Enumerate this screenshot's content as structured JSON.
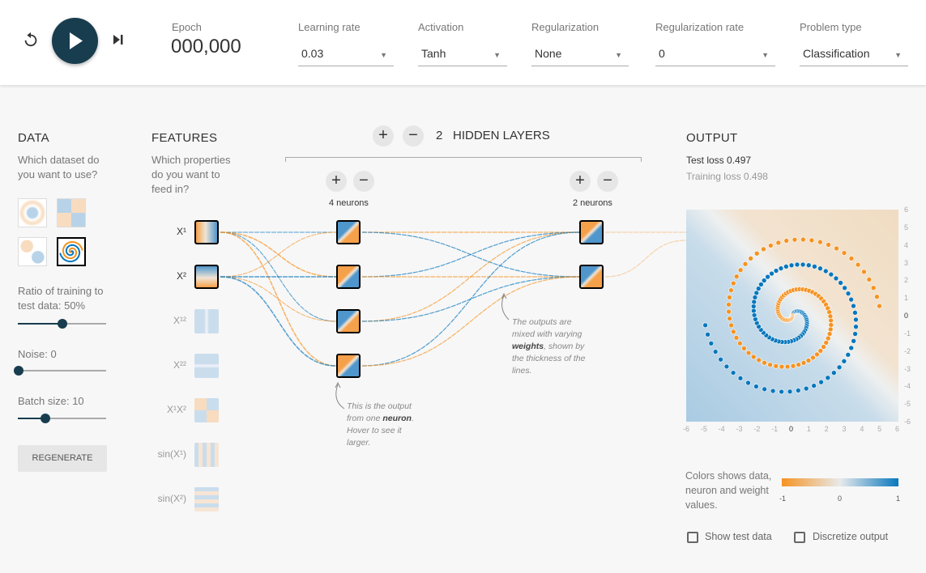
{
  "header": {
    "epoch_label": "Epoch",
    "epoch_value": "000,000",
    "controls": [
      {
        "label": "Learning rate",
        "value": "0.03"
      },
      {
        "label": "Activation",
        "value": "Tanh"
      },
      {
        "label": "Regularization",
        "value": "None"
      },
      {
        "label": "Regularization rate",
        "value": "0"
      },
      {
        "label": "Problem type",
        "value": "Classification"
      }
    ],
    "icons": {
      "reset": "reset-icon",
      "play": "play-icon",
      "step": "step-icon"
    }
  },
  "data": {
    "title": "DATA",
    "question": "Which dataset do you want to use?",
    "selected_dataset": "spiral",
    "ratio_label": "Ratio of training to test data:  50%",
    "ratio": 50,
    "noise_label": "Noise:  0",
    "noise": 0,
    "batch_label": "Batch size:  10",
    "batch": 10,
    "regenerate": "REGENERATE"
  },
  "features": {
    "title": "FEATURES",
    "question": "Which properties do you want to feed in?",
    "items": [
      {
        "label": "X¹",
        "active": true
      },
      {
        "label": "X²",
        "active": true
      },
      {
        "label": "X¹²",
        "active": false
      },
      {
        "label": "X²²",
        "active": false
      },
      {
        "label": "X¹X²",
        "active": false
      },
      {
        "label": "sin(X¹)",
        "active": false
      },
      {
        "label": "sin(X²)",
        "active": false
      }
    ]
  },
  "network": {
    "plus": "+",
    "minus": "−",
    "layers_count": "2",
    "layers_label": "HIDDEN LAYERS",
    "layers": [
      {
        "neurons_label": "4 neurons"
      },
      {
        "neurons_label": "2 neurons"
      }
    ],
    "note1_a": "This is the output from one ",
    "note1_b": "neuron",
    "note1_c": ". Hover to see it larger.",
    "note2_a": "The outputs are mixed with varying ",
    "note2_b": "weights",
    "note2_c": ", shown by the thickness of the lines."
  },
  "output": {
    "title": "OUTPUT",
    "test_loss": "Test loss 0.497",
    "training_loss": "Training loss 0.498",
    "axis_ticks": [
      "-6",
      "-5",
      "-4",
      "-3",
      "-2",
      "-1",
      "0",
      "1",
      "2",
      "3",
      "4",
      "5",
      "6"
    ],
    "legend_text": "Colors shows data, neuron and weight values.",
    "legend_ticks": [
      "-1",
      "0",
      "1"
    ],
    "show_test": "Show test data",
    "discretize": "Discretize output"
  },
  "colors": {
    "orange": "#f59322",
    "blue": "#0877bd",
    "dark": "#183d4e"
  }
}
